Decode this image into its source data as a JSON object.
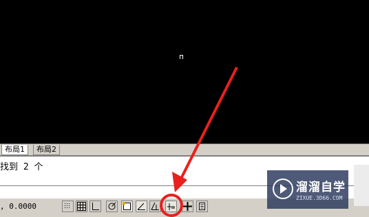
{
  "layout_tabs": [
    {
      "label": "布局1"
    },
    {
      "label": "布局2"
    }
  ],
  "command": {
    "output": "找到 2 个"
  },
  "status": {
    "coordinates": ", 0.0000",
    "buttons": [
      {
        "icon": "snap-icon",
        "state": "off"
      },
      {
        "icon": "grid-icon",
        "state": "off"
      },
      {
        "icon": "ortho-icon",
        "state": "off"
      },
      {
        "icon": "polar-icon",
        "state": "off"
      },
      {
        "icon": "osnap-icon",
        "state": "on"
      },
      {
        "icon": "otrack-icon",
        "state": "on"
      },
      {
        "icon": "ducs-icon",
        "state": "off"
      },
      {
        "icon": "dyn-icon",
        "state": "on"
      },
      {
        "icon": "lineweight-icon",
        "state": "off"
      },
      {
        "icon": "qp-icon",
        "state": "off"
      }
    ]
  },
  "annotation": {
    "color": "#e8201e"
  },
  "watermark": {
    "title": "溜溜自学",
    "subtitle": "ZIXUE.3D66.COM"
  }
}
